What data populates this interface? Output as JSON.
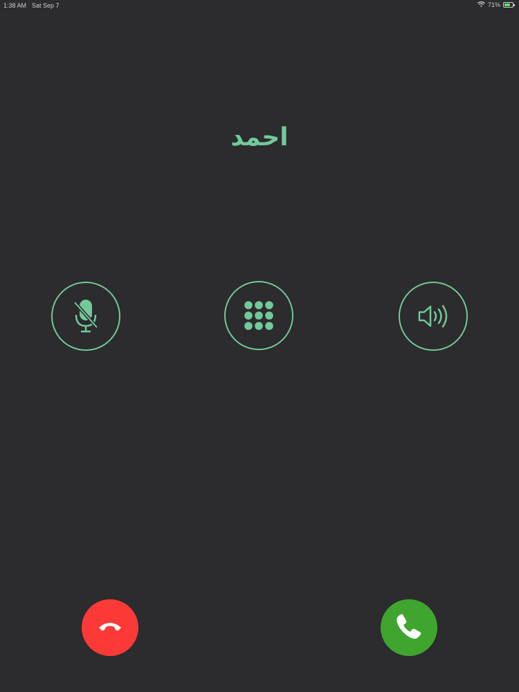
{
  "status_bar": {
    "time": "1:38 AM",
    "date": "Sat Sep 7",
    "battery_percent": "71%",
    "battery_level": 0.71
  },
  "call": {
    "caller_name": "احمد"
  },
  "controls": {
    "mute_icon": "mic-muted-icon",
    "keypad_icon": "keypad-icon",
    "speaker_icon": "speaker-icon"
  },
  "actions": {
    "decline_icon": "hang-up-icon",
    "answer_icon": "phone-icon"
  },
  "colors": {
    "background": "#2c2b2d",
    "accent": "#72c99a",
    "decline": "#fb3a37",
    "answer": "#3fa52f"
  }
}
